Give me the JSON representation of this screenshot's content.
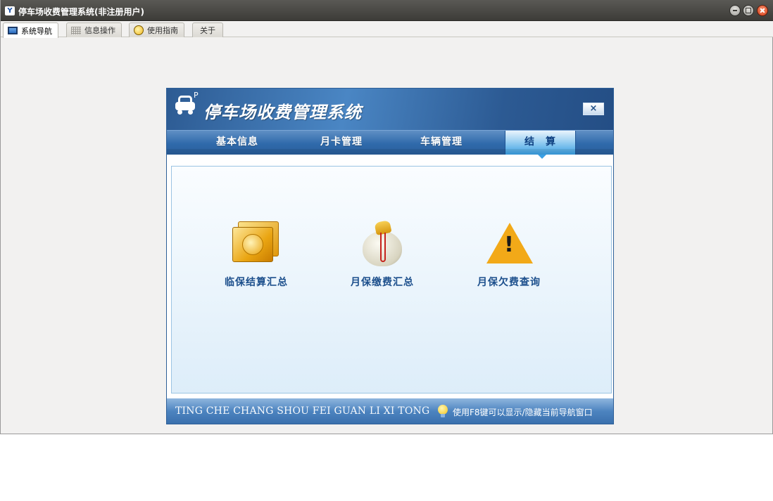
{
  "window": {
    "title": "停车场收费管理系统(非注册用户)",
    "app_icon": "Y",
    "controls": [
      "minimize-icon",
      "maximize-icon",
      "close-icon"
    ]
  },
  "tabs": [
    {
      "label": "系统导航",
      "icon": "monitor-icon",
      "active": true
    },
    {
      "label": "信息操作",
      "icon": "grid-icon",
      "active": false
    },
    {
      "label": "使用指南",
      "icon": "help-icon",
      "active": false
    },
    {
      "label": "关于",
      "icon": "",
      "active": false
    }
  ],
  "panel": {
    "logo_letter": "P",
    "title": "停车场收费管理系统",
    "close_label": "×",
    "nav": [
      {
        "label": "基本信息",
        "active": false
      },
      {
        "label": "月卡管理",
        "active": false
      },
      {
        "label": "车辆管理",
        "active": false
      },
      {
        "label": "结　算",
        "active": true
      }
    ],
    "features": [
      {
        "label": "临保结算汇总",
        "icon": "gold-stack-icon"
      },
      {
        "label": "月保缴费汇总",
        "icon": "money-bag-icon"
      },
      {
        "label": "月保欠费查询",
        "icon": "warning-icon"
      }
    ],
    "footer": {
      "pinyin": "TING CHE CHANG SHOU FEI  GUAN LI XI TONG",
      "tip": "使用F8键可以显示/隐藏当前导航窗口",
      "tip_icon": "bulb-icon"
    }
  },
  "colors": {
    "banner": "#2d5b93",
    "nav_active": "#3aa0e4",
    "label_text": "#1c4f8c",
    "close_button": "#d8411a"
  }
}
